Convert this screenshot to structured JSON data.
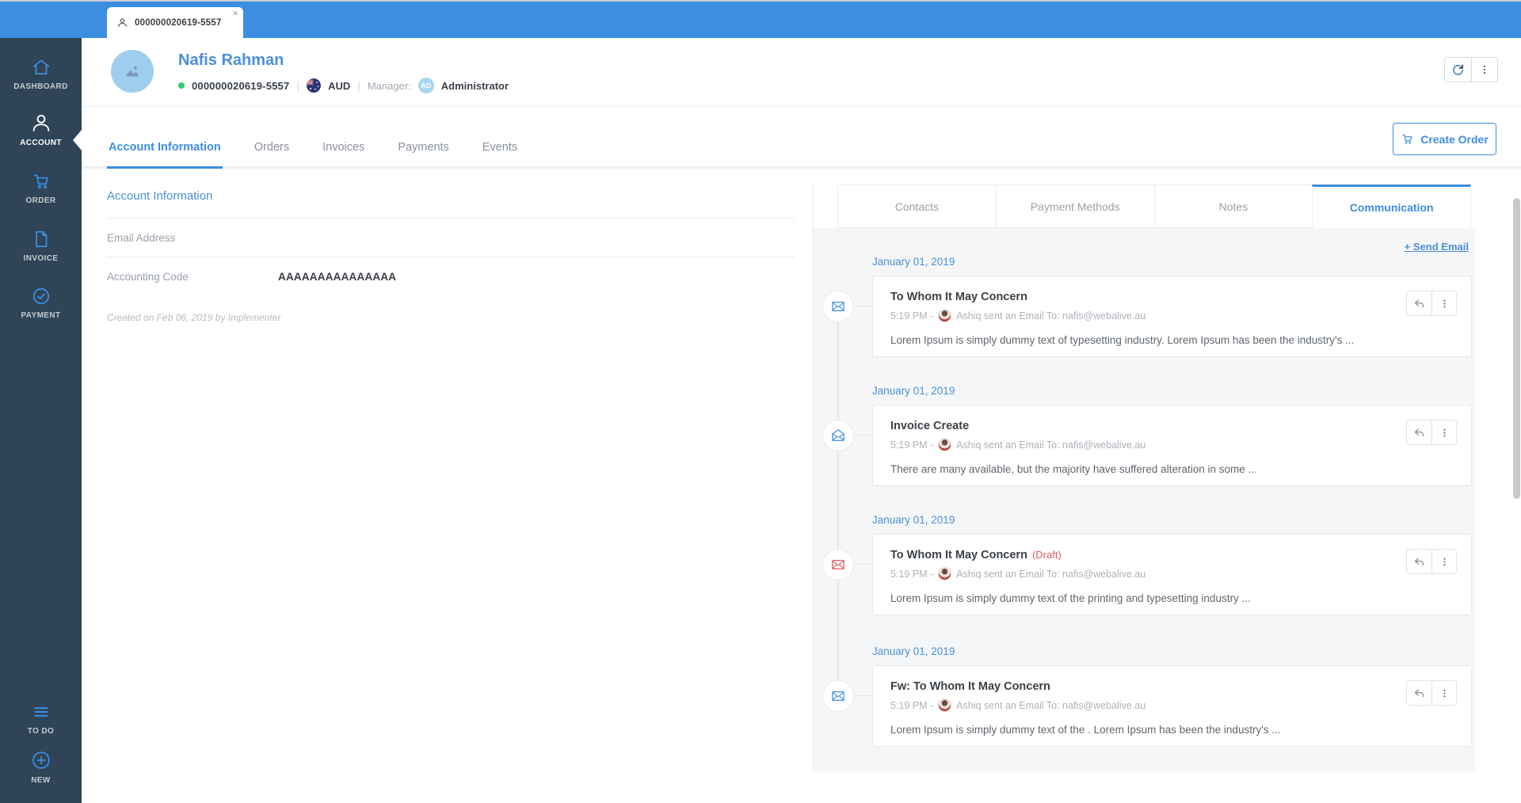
{
  "topbar": {
    "tab_label": "000000020619-5557",
    "tab_close": "×",
    "icons": {
      "tab_person": "person-icon",
      "bell": "notification-bell-icon",
      "avatar": "user-avatar-photo"
    }
  },
  "sidebar": {
    "logo_icon": "brand-logo-c-arrow",
    "items": [
      {
        "label": "DASHBOARD",
        "icon": "home-icon",
        "active": false
      },
      {
        "label": "ACCOUNT",
        "icon": "person-icon",
        "active": true
      },
      {
        "label": "ORDER",
        "icon": "cart-icon",
        "active": false
      },
      {
        "label": "INVOICE",
        "icon": "document-icon",
        "active": false
      },
      {
        "label": "PAYMENT",
        "icon": "check-circle-icon",
        "active": false
      }
    ],
    "bottom_items": [
      {
        "label": "TO DO",
        "icon": "list-lines-icon"
      },
      {
        "label": "NEW",
        "icon": "plus-circle-icon"
      }
    ]
  },
  "header": {
    "name": "Nafis Rahman",
    "status_color": "#2ecc71",
    "account_number": "000000020619-5557",
    "currency": "AUD",
    "flag_icon": "australia-flag-icon",
    "manager_label": "Manager:",
    "manager_badge": "AD",
    "manager_name": "Administrator",
    "action_icons": [
      "refresh-icon",
      "kebab-menu-icon"
    ]
  },
  "main_tabs": [
    "Account Information",
    "Orders",
    "Invoices",
    "Payments",
    "Events"
  ],
  "create_order": {
    "label": "Create Order",
    "icon": "cart-icon",
    "accent": "#3d8ee0"
  },
  "account_info": {
    "title": "Account Information",
    "rows": [
      {
        "label": "Email Address",
        "value": ""
      },
      {
        "label": "Accounting Code",
        "value": "AAAAAAAAAAAAAAA"
      }
    ],
    "created_note": "Created on Feb 06, 2019 by Implementer"
  },
  "panel": {
    "tabs": [
      "Contacts",
      "Payment Methods",
      "Notes",
      "Communication"
    ],
    "active_tab": "Communication",
    "send_email": "+ Send Email",
    "entries": [
      {
        "date": "January 01, 2019",
        "title": "To Whom It May Concern",
        "draft": "",
        "time": "5:19 PM -",
        "sender": "Ashiq sent an Email To: nafis@webalive.au",
        "body": "Lorem Ipsum is simply dummy text of  typesetting industry. Lorem Ipsum has been the industry's ...",
        "icon": "envelope-closed-icon",
        "icon_color": "#3d8ee0"
      },
      {
        "date": "January 01, 2019",
        "title": "Invoice Create",
        "draft": "",
        "time": "5:19 PM -",
        "sender": "Ashiq sent an Email To: nafis@webalive.au",
        "body": "There are many available, but the majority have suffered alteration in some ...",
        "icon": "envelope-open-icon",
        "icon_color": "#3d8ee0"
      },
      {
        "date": "January 01, 2019",
        "title": "To Whom It May Concern",
        "draft": "(Draft)",
        "time": "5:19 PM -",
        "sender": "Ashiq sent an Email To: nafis@webalive.au",
        "body": "Lorem Ipsum is simply dummy text of the printing and typesetting industry ...",
        "icon": "envelope-closed-icon",
        "icon_color": "#e05b5b"
      },
      {
        "date": "January 01, 2019",
        "title": "Fw: To Whom It May Concern",
        "draft": "",
        "time": "5:19 PM -",
        "sender": "Ashiq sent an Email To: nafis@webalive.au",
        "body": "Lorem Ipsum is simply dummy text of the . Lorem Ipsum has been the industry's ...",
        "icon": "envelope-closed-icon",
        "icon_color": "#3d8ee0"
      }
    ]
  }
}
